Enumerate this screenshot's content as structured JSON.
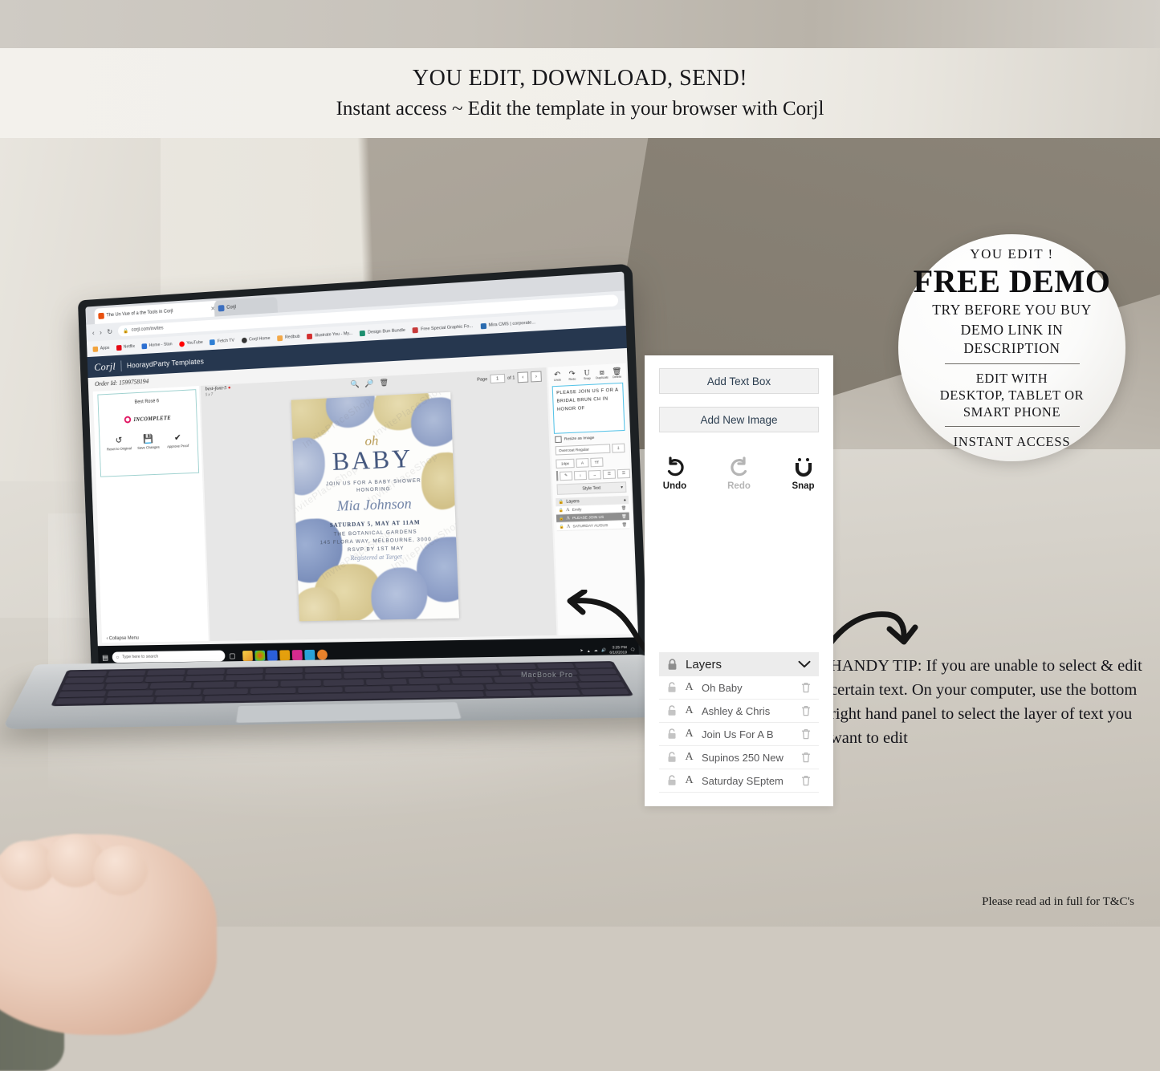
{
  "banner": {
    "line1": "YOU EDIT, DOWNLOAD, SEND!",
    "line2": "Instant access ~ Edit the template in your browser with Corjl"
  },
  "badge": {
    "eyebrow": "YOU EDIT !",
    "headline": "FREE DEMO",
    "sub1": "TRY BEFORE YOU BUY",
    "sub2": "DEMO LINK IN DESCRIPTION",
    "edit_with": "EDIT WITH",
    "devices1": "DESKTOP, TABLET OR",
    "devices2": "SMART PHONE",
    "instant": "INSTANT ACCESS"
  },
  "panel": {
    "add_text_box": "Add Text Box",
    "add_new_image": "Add New Image",
    "tools": [
      {
        "label": "Undo",
        "icon": "undo-icon",
        "disabled": false
      },
      {
        "label": "Redo",
        "icon": "redo-icon",
        "disabled": true
      },
      {
        "label": "Snap",
        "icon": "magnet-icon",
        "disabled": false
      }
    ],
    "layers": {
      "title": "Layers",
      "lock_icon": "lock-closed-icon",
      "collapse_icon": "chevron-down-icon",
      "rows": [
        {
          "name": "Oh Baby"
        },
        {
          "name": "Ashley & Chris"
        },
        {
          "name": "Join Us For A B"
        },
        {
          "name": "Supinos 250 New"
        },
        {
          "name": "Saturday SEptem"
        }
      ]
    }
  },
  "tip": {
    "text": "HANDY TIP: If you are unable to select & edit certain text. On your computer, use the bottom right hand panel to select the layer of text you want to edit"
  },
  "footer": {
    "text": "Please read ad in full for T&C's"
  },
  "laptop": {
    "brand": "MacBook Pro",
    "browser": {
      "tab1": "The Un Vue of a the Tools in Corjl",
      "tab2": "Corjl",
      "url": "corjl.com/invites",
      "nav": {
        "back": "‹",
        "forward": "›",
        "reload": "↻"
      },
      "bookmarks": [
        {
          "label": "Apps"
        },
        {
          "label": "Netflix"
        },
        {
          "label": "Home - Stan"
        },
        {
          "label": "YouTube"
        },
        {
          "label": "Fetch TV"
        },
        {
          "label": "Corjl Home"
        },
        {
          "label": "Redbub"
        },
        {
          "label": "Illustrate You - My..."
        },
        {
          "label": "Design Bun Bundle"
        },
        {
          "label": "Free Special Graphic Fo..."
        },
        {
          "label": "Mira CMS | corporate..."
        }
      ]
    },
    "app": {
      "logo": "Corjl",
      "shop": "HooraydParty Templates",
      "order_id": "Order Id: 1599758194",
      "collapse_menu": "Collapse Menu",
      "order_card": {
        "title": "Best Rosé 6",
        "status": "INCOMPLETE",
        "actions": [
          {
            "label": "Reset to Original",
            "icon": "reset-icon"
          },
          {
            "label": "Save Changes",
            "icon": "save-icon"
          },
          {
            "label": "Approve Proof",
            "icon": "check-icon"
          }
        ]
      },
      "canvas": {
        "file_name": "best-font-5",
        "file_size": "5 x 7",
        "zoom_in": "zoom-in-icon",
        "zoom_out": "zoom-out-icon",
        "delete": "trash-icon",
        "page_label": "Page",
        "page_value": "1",
        "page_of": "of 1",
        "prev": "‹",
        "next": "›"
      },
      "invitation": {
        "oh": "oh",
        "baby": "BABY",
        "join": "JOIN US FOR A BABY SHOWER",
        "honoring": "HONORING",
        "name": "Mia Johnson",
        "date": "SATURDAY 5, MAY AT 11AM",
        "venue": "THE BOTANICAL GARDENS",
        "address": "145 FLORA WAY, MELBOURNE, 3000",
        "rsvp": "RSVP BY 1ST MAY",
        "hosts": "Registered at Target",
        "watermark": "InvitePlaceShop"
      },
      "editor": {
        "tools": [
          {
            "label": "Undo",
            "icon": "undo-icon"
          },
          {
            "label": "Redo",
            "icon": "redo-icon"
          },
          {
            "label": "Snap",
            "icon": "magnet-icon"
          },
          {
            "label": "Duplicate",
            "icon": "duplicate-icon"
          },
          {
            "label": "Delete",
            "icon": "trash-icon"
          }
        ],
        "text_value": "PLEASE JOIN US F\nOR A BRIDAL BRUN\nCH\nIN HONOR OF",
        "resize_label": "Resize as Image",
        "font_family": "Overcoat Regular",
        "font_size": "14px",
        "style_text": "Style Text",
        "color": "#111111",
        "layers": [
          {
            "name": "Emily",
            "selected": false
          },
          {
            "name": "PLEASE JOIN US",
            "selected": true
          },
          {
            "name": "SATURDAY AUGUS",
            "selected": false
          }
        ]
      }
    },
    "taskbar": {
      "search_placeholder": "Type here to search",
      "time": "3:25 PM",
      "date": "6/10/2019"
    }
  }
}
